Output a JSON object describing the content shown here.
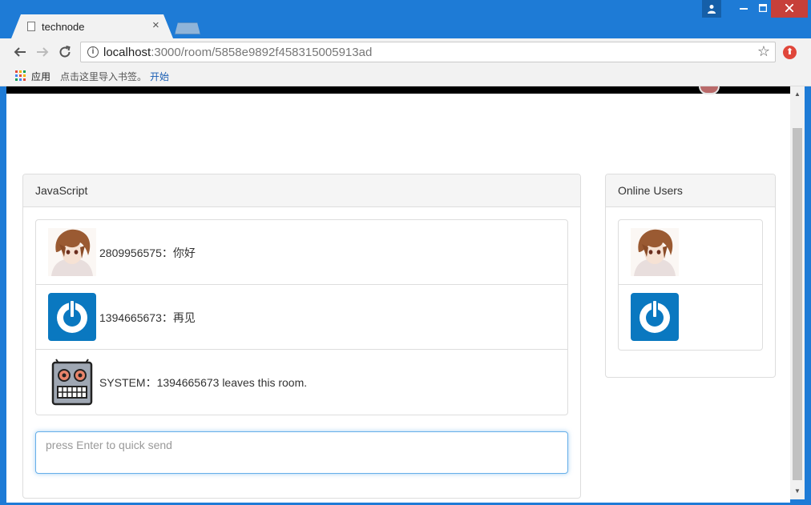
{
  "browser": {
    "tab_title": "technode",
    "tab_close": "×",
    "url_host": "localhost",
    "url_path": ":3000/room/5858e9892f458315005913ad",
    "bookmarks": {
      "apps_label": "应用",
      "hint": "点击这里导入书签。",
      "start_link": "开始"
    }
  },
  "room": {
    "name": "JavaScript",
    "messages": [
      {
        "avatar": "anime-avatar",
        "text": "2809956575：你好"
      },
      {
        "avatar": "power-avatar",
        "text": "1394665673：再见"
      },
      {
        "avatar": "robot-avatar",
        "text": "SYSTEM：1394665673 leaves this room."
      }
    ],
    "input": {
      "placeholder": "press Enter to quick send",
      "value": ""
    }
  },
  "online_users": {
    "title": "Online Users",
    "users": [
      {
        "avatar": "anime-avatar"
      },
      {
        "avatar": "power-avatar"
      }
    ]
  },
  "colors": {
    "chrome_blue": "#1e7bd6",
    "close_red": "#c7403a",
    "power_blue": "#0a78c0",
    "focus_blue": "#66afe9"
  }
}
